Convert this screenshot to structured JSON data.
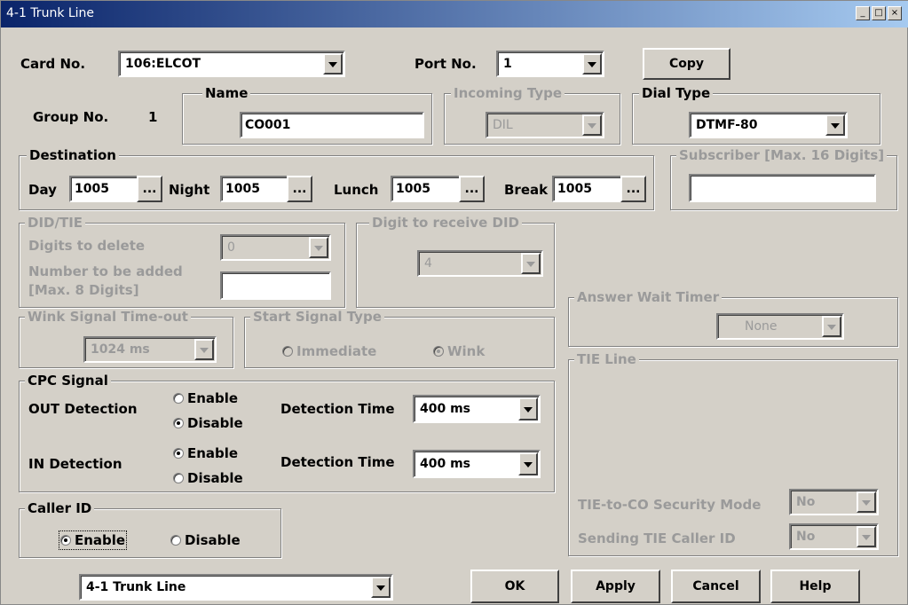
{
  "window": {
    "title": "4-1 Trunk Line"
  },
  "card": {
    "label": "Card No.",
    "value": "106:ELCOT"
  },
  "port": {
    "label": "Port No.",
    "value": "1"
  },
  "copy_button": "Copy",
  "group": {
    "label": "Group No.",
    "value": "1"
  },
  "name": {
    "caption": "Name",
    "value": "CO001"
  },
  "incoming_type": {
    "caption": "Incoming Type",
    "value": "DIL"
  },
  "dial_type": {
    "caption": "Dial Type",
    "value": "DTMF-80"
  },
  "destination": {
    "caption": "Destination",
    "day_label": "Day",
    "day": "1005",
    "night_label": "Night",
    "night": "1005",
    "lunch_label": "Lunch",
    "lunch": "1005",
    "break_label": "Break",
    "break": "1005",
    "browse": "..."
  },
  "subscriber": {
    "caption": "Subscriber [Max. 16 Digits]",
    "value": ""
  },
  "did_tie": {
    "caption": "DID/TIE",
    "digits_delete_label": "Digits to delete",
    "digits_delete": "0",
    "number_added_label": "Number to be added",
    "number_added_label2": "[Max. 8 Digits]",
    "number_added": ""
  },
  "digit_receive": {
    "caption": "Digit to receive DID",
    "value": "4"
  },
  "answer_wait": {
    "caption": "Answer Wait Timer",
    "value": "None"
  },
  "wink": {
    "caption": "Wink Signal Time-out",
    "value": "1024 ms"
  },
  "start_signal": {
    "caption": "Start Signal Type",
    "immediate": "Immediate",
    "wink": "Wink",
    "selected": "wink"
  },
  "tie_line": {
    "caption": "TIE Line",
    "security_label": "TIE-to-CO Security Mode",
    "security": "No",
    "sending_label": "Sending TIE Caller ID",
    "sending": "No"
  },
  "cpc": {
    "caption": "CPC Signal",
    "out_label": "OUT Detection",
    "in_label": "IN Detection",
    "enable": "Enable",
    "disable": "Disable",
    "out_selected": "disable",
    "in_selected": "enable",
    "time_label": "Detection Time",
    "out_time": "400  ms",
    "in_time": "400  ms"
  },
  "caller_id": {
    "caption": "Caller ID",
    "enable": "Enable",
    "disable": "Disable",
    "selected": "enable"
  },
  "nav": {
    "value": "4-1 Trunk Line"
  },
  "buttons": {
    "ok": "OK",
    "apply": "Apply",
    "cancel": "Cancel",
    "help": "Help"
  },
  "colors": {
    "title_start": "#0a246a",
    "title_end": "#a6caf0",
    "face": "#d4d0c8",
    "disabled_text": "#9a9a9a"
  }
}
